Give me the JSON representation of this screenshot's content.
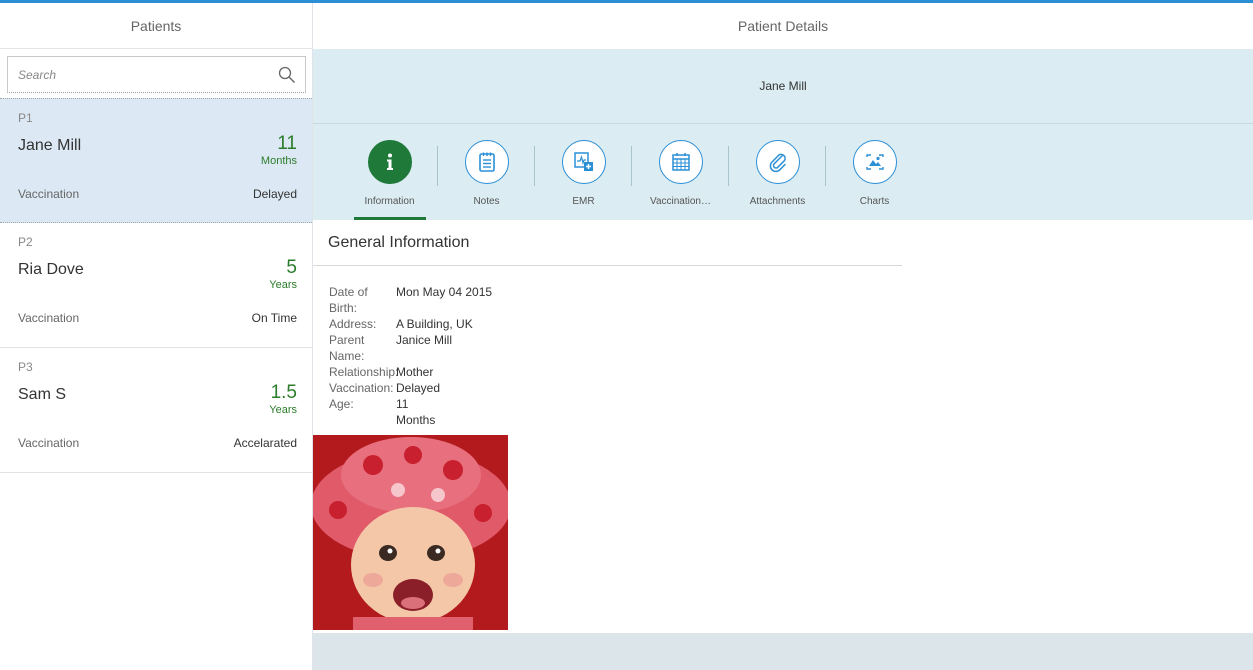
{
  "master": {
    "title": "Patients",
    "search": {
      "placeholder": "Search"
    },
    "items": [
      {
        "id": "P1",
        "name": "Jane Mill",
        "number": "11",
        "unit": "Months",
        "attr_label": "Vaccination",
        "attr_value": "Delayed"
      },
      {
        "id": "P2",
        "name": "Ria Dove",
        "number": "5",
        "unit": "Years",
        "attr_label": "Vaccination",
        "attr_value": "On Time"
      },
      {
        "id": "P3",
        "name": "Sam S",
        "number": "1.5",
        "unit": "Years",
        "attr_label": "Vaccination",
        "attr_value": "Accelarated"
      }
    ]
  },
  "detail": {
    "title": "Patient Details",
    "object_title": "Jane Mill",
    "tabs": [
      {
        "label": "Information",
        "icon": "info-icon"
      },
      {
        "label": "Notes",
        "icon": "notes-icon"
      },
      {
        "label": "EMR",
        "icon": "emr-icon"
      },
      {
        "label": "Vaccination…",
        "icon": "calendar-icon"
      },
      {
        "label": "Attachments",
        "icon": "paperclip-icon"
      },
      {
        "label": "Charts",
        "icon": "image-chart-icon"
      }
    ],
    "section_title": "General Information",
    "fields": {
      "dob_label": "Date of Birth:",
      "dob_value": "Mon May 04 2015",
      "address_label": "Address:",
      "address_value": "A Building, UK",
      "parent_label": "Parent Name:",
      "parent_value": "Janice Mill",
      "relationship_label": "Relationship:",
      "relationship_value": "Mother",
      "vaccination_label": "Vaccination:",
      "vaccination_value": "Delayed",
      "age_label": "Age:",
      "age_value": "11",
      "age_unit": "Months"
    }
  },
  "colors": {
    "accent": "#2b8fd6",
    "positive": "#2b7c2b",
    "active_tab": "#1f7a3a",
    "header_bg": "#dbecf2",
    "selected_bg": "#dce9f4"
  }
}
